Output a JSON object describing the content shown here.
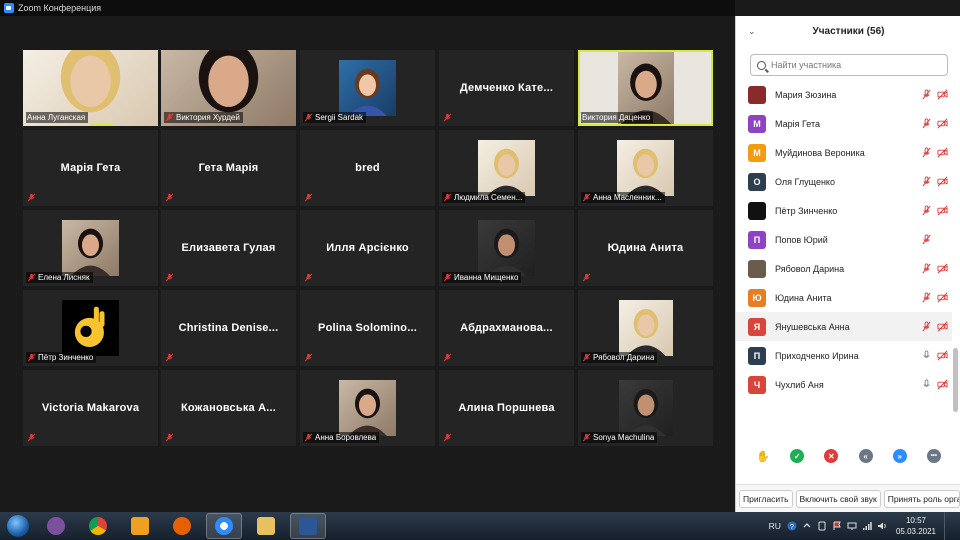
{
  "window": {
    "title": "Zoom Конференция"
  },
  "colors": {
    "active_speaker": "#d7ea3c",
    "mute_red": "#e03b3b",
    "tile_bg": "#242424",
    "panel_bg": "#ffffff"
  },
  "gallery": {
    "tiles": [
      {
        "name": "Анна Луганская",
        "mode": "video",
        "muted": false
      },
      {
        "name": "Виктория Хурдей",
        "mode": "video",
        "muted": true
      },
      {
        "name": "Sergii Sardak",
        "mode": "photo",
        "muted": true
      },
      {
        "name": "Демченко Кате...",
        "mode": "name",
        "muted": true
      },
      {
        "name": "Виктория Даценко",
        "mode": "video",
        "muted": false,
        "active": true
      },
      {
        "name": "Марія Гета",
        "mode": "name",
        "muted": true
      },
      {
        "name": "Гета Марія",
        "mode": "name",
        "muted": true
      },
      {
        "name": "bred",
        "mode": "name",
        "muted": true
      },
      {
        "name": "Людмила Семен...",
        "mode": "photo",
        "muted": true
      },
      {
        "name": "Анна Масленник...",
        "mode": "photo",
        "muted": true
      },
      {
        "name": "Елена Лисняк",
        "mode": "photo",
        "muted": true
      },
      {
        "name": "Елизавета Гулая",
        "mode": "name",
        "muted": true
      },
      {
        "name": "Илля Арсієнко",
        "mode": "name",
        "muted": true
      },
      {
        "name": "Иванна Мищенко",
        "mode": "photo",
        "muted": true
      },
      {
        "name": "Юдина Анита",
        "mode": "name",
        "muted": true
      },
      {
        "name": "Пётр Зинченко",
        "mode": "photo",
        "muted": true
      },
      {
        "name": "Christina  Denise...",
        "mode": "name",
        "muted": true
      },
      {
        "name": "Polina  Solomino...",
        "mode": "name",
        "muted": true
      },
      {
        "name": "Абдрахманова...",
        "mode": "name",
        "muted": true
      },
      {
        "name": "Рябовол Дарина",
        "mode": "photo",
        "muted": true
      },
      {
        "name": "Victoria Makarova",
        "mode": "name",
        "muted": true
      },
      {
        "name": "Кожановська  А...",
        "mode": "name",
        "muted": true
      },
      {
        "name": "Анна Боровлева",
        "mode": "photo",
        "muted": true
      },
      {
        "name": "Алина Поршнева",
        "mode": "name",
        "muted": true
      },
      {
        "name": "Sonya Machulina",
        "mode": "photo",
        "muted": true
      }
    ]
  },
  "participants_panel": {
    "title": "Участники (56)",
    "collapse_glyph": "⌄",
    "search_placeholder": "Найти участника",
    "rows": [
      {
        "name": "Мария Зюзина",
        "initial": "",
        "avatar_color": "#8b2a2a",
        "mic_muted": true,
        "video_off": true
      },
      {
        "name": "Марія Гета",
        "initial": "М",
        "avatar_color": "#8e44c2",
        "mic_muted": true,
        "video_off": true
      },
      {
        "name": "Муйдинова Вероника",
        "initial": "М",
        "avatar_color": "#f39c12",
        "mic_muted": true,
        "video_off": true
      },
      {
        "name": "Оля Глущенко",
        "initial": "О",
        "avatar_color": "#2c3e50",
        "mic_muted": true,
        "video_off": true
      },
      {
        "name": "Пётр Зинченко",
        "initial": "",
        "avatar_color": "#111111",
        "mic_muted": true,
        "video_off": true
      },
      {
        "name": "Попов Юрий",
        "initial": "П",
        "avatar_color": "#8e44c2",
        "mic_muted": true,
        "video_off": false
      },
      {
        "name": "Рябовол Дарина",
        "initial": "",
        "avatar_color": "#6b5b4b",
        "mic_muted": true,
        "video_off": true
      },
      {
        "name": "Юдина Анита",
        "initial": "Ю",
        "avatar_color": "#e67e22",
        "mic_muted": true,
        "video_off": true
      },
      {
        "name": "Янушевська Анна",
        "initial": "Я",
        "avatar_color": "#d9453b",
        "mic_muted": true,
        "video_off": true,
        "hover": true
      },
      {
        "name": "Приходченко Ирина",
        "initial": "П",
        "avatar_color": "#2c3e50",
        "mic_muted": false,
        "video_off": true
      },
      {
        "name": "Чухлиб Аня",
        "initial": "Ч",
        "avatar_color": "#d9453b",
        "mic_muted": false,
        "video_off": true
      }
    ],
    "reactions": [
      {
        "icon": "raise-hand-icon",
        "color": "#2d8cff",
        "glyph": "✋"
      },
      {
        "icon": "yes-icon",
        "color": "#1eae56",
        "glyph": "✓"
      },
      {
        "icon": "no-icon",
        "color": "#e03b3b",
        "glyph": "✕"
      },
      {
        "icon": "slower-icon",
        "color": "#6b7785",
        "glyph": "«"
      },
      {
        "icon": "faster-icon",
        "color": "#2d8cff",
        "glyph": "»"
      },
      {
        "icon": "more-icon",
        "color": "#6b7785",
        "glyph": "•••"
      }
    ],
    "footer": {
      "invite_label": "Пригласить",
      "unmute_label": "Включить свой звук",
      "claim_host_label": "Принять роль организатора"
    }
  },
  "taskbar": {
    "lang": "RU",
    "time": "10:57",
    "date": "05.03.2021",
    "apps": [
      {
        "icon": "viber-icon",
        "color": "#7b519d"
      },
      {
        "icon": "chrome-icon",
        "color": "#db4437"
      },
      {
        "icon": "media-player-icon",
        "color": "#f0a020"
      },
      {
        "icon": "firefox-icon",
        "color": "#e66000"
      },
      {
        "icon": "zoom-icon",
        "color": "#2d8cff",
        "active": true
      },
      {
        "icon": "explorer-icon",
        "color": "#e8c060"
      },
      {
        "icon": "word-icon",
        "color": "#2b5797",
        "active": true
      }
    ]
  }
}
